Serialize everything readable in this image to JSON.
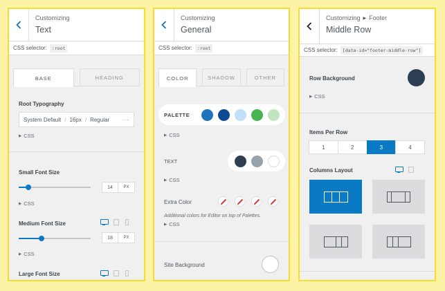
{
  "panel1": {
    "breadcrumb": "Customizing",
    "title": "Text",
    "css_selector_label": "CSS selector:",
    "css_selector_value": ":root",
    "tabs": [
      {
        "label": "BASE",
        "active": true
      },
      {
        "label": "HEADING",
        "active": false
      }
    ],
    "root_typography": {
      "label": "Root Typography",
      "family": "System Default",
      "size": "16px",
      "weight": "Regular",
      "more": "···"
    },
    "css_toggle": "CSS",
    "small_font": {
      "label": "Small Font Size",
      "value": "14",
      "unit": "PX",
      "slider_fraction": 0.13
    },
    "medium_font": {
      "label": "Medium Font Size",
      "value": "18",
      "unit": "PX",
      "slider_fraction": 0.32
    },
    "large_font": {
      "label": "Large Font Size"
    }
  },
  "panel2": {
    "breadcrumb": "Customizing",
    "title": "General",
    "css_selector_label": "CSS selector:",
    "css_selector_value": ":root",
    "tabs": [
      {
        "label": "COLOR",
        "active": true
      },
      {
        "label": "SHADOW",
        "active": false
      },
      {
        "label": "OTHER",
        "active": false
      }
    ],
    "palette": {
      "label": "PALETTE",
      "colors": [
        "#1e73be",
        "#0d4a94",
        "#bfe0f7",
        "#46b450",
        "#bfe6c1"
      ]
    },
    "text": {
      "label": "TEXT",
      "colors": [
        "#2c3e50",
        "#97a2aa",
        "#ffffff"
      ]
    },
    "extra": {
      "label": "Extra Color",
      "note": "Additional colors for Editor on top of Palettes."
    },
    "css_toggle": "CSS",
    "site_background": {
      "label": "Site Background",
      "color": "#ffffff"
    }
  },
  "panel3": {
    "breadcrumb_parent": "Customizing",
    "breadcrumb_child": "Footer",
    "title": "Middle Row",
    "css_selector_label": "CSS selector:",
    "css_selector_value": "[data-id=\"footer-middle-row\"]",
    "row_background": {
      "label": "Row Background",
      "color": "#2c3e50"
    },
    "css_toggle": "CSS",
    "items_per_row": {
      "label": "Items Per Row",
      "options": [
        "1",
        "2",
        "3",
        "4"
      ],
      "selected": "3"
    },
    "columns_layout": {
      "label": "Columns Layout"
    }
  },
  "colors": {
    "accent": "#0a7ac5",
    "border": "#f5dc2f",
    "background": "#fdf3a6"
  }
}
